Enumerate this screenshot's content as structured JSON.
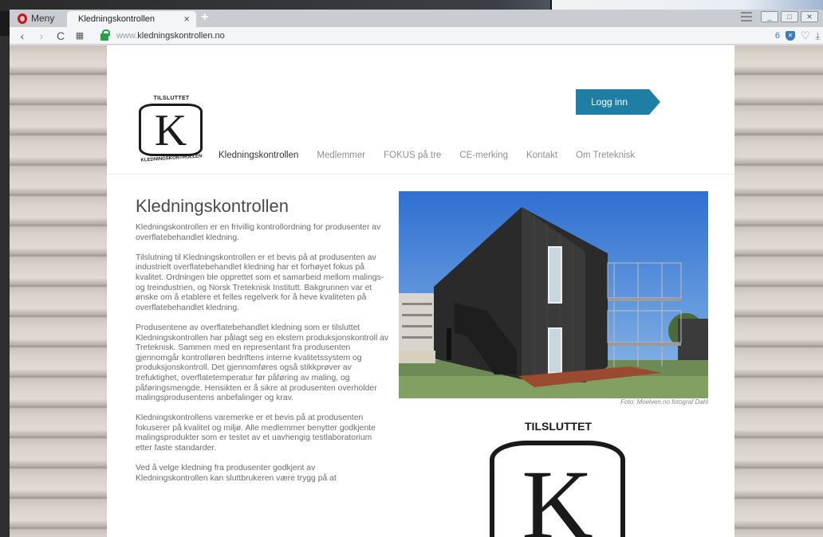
{
  "browser": {
    "menu_label": "Meny",
    "tab_title": "Kledningskontrollen",
    "tab_close": "×",
    "new_tab": "+",
    "url_prefix": "www.",
    "url_domain": "kledningskontrollen.no",
    "adblock_count": "6",
    "nav_back": "‹",
    "nav_forward": "›",
    "reload": "C",
    "speed_dial": "▦"
  },
  "site": {
    "logo_top": "TILSLUTTET",
    "logo_letter": "K",
    "logo_bottom": "KLEDNINGSKONTROLLEN",
    "login_label": "Logg inn",
    "nav": [
      {
        "label": "Kledningskontrollen",
        "active": true
      },
      {
        "label": "Medlemmer",
        "active": false
      },
      {
        "label": "FOKUS på tre",
        "active": false
      },
      {
        "label": "CE-merking",
        "active": false
      },
      {
        "label": "Kontakt",
        "active": false
      },
      {
        "label": "Om Treteknisk",
        "active": false
      }
    ],
    "title": "Kledningskontrollen",
    "paragraphs": [
      "Kledningskontrollen er en frivillig kontrollordning for produsenter av overflatebehandlet kledning.",
      "Tilslutning til Kledningskontrollen er et bevis på at produsenten av industrielt overflatebehandlet kledning har et forhøyet fokus på kvalitet. Ordningen ble opprettet som et samarbeid mellom malings- og treindustrien, og Norsk Treteknisk Institutt. Bakgrunnen var et ønske om å etablere et felles regelverk for å heve kvaliteten på overflatebehandlet kledning.",
      "Produsentene av overflatebehandlet kledning som er tilsluttet Kledningskontrollen har pålagt seg en ekstern produksjonskontroll av Treteknisk. Sammen med en representant fra produsenten gjennomgår kontrolløren bedriftens interne kvalitetssystem og produksjonskontroll. Det gjennomføres også stikkprøver av trefuktighet, overflatetemperatur før påføring av maling, og påføringsmengde. Hensikten er å sikre at produsenten overholder malingsprodusentens anbefalinger og krav.",
      "Kledningskontrollens varemerke er et bevis på at produsenten fokuserer på kvalitet og miljø. Alle medlemmer benytter godkjente malingsprodukter som er testet av et uavhengig testlaboratorium etter faste standarder.",
      "Ved å velge kledning fra produsenter godkjent av Kledningskontrollen kan sluttbrukeren være trygg på at"
    ],
    "photo_caption": "Foto: Moelven.no fotograf Dahl",
    "big_logo_top": "TILSLUTTET",
    "big_logo_letter": "K"
  },
  "colors": {
    "accent": "#1f7ea3",
    "opera_red": "#d10e1e",
    "secure_green": "#25a244"
  }
}
